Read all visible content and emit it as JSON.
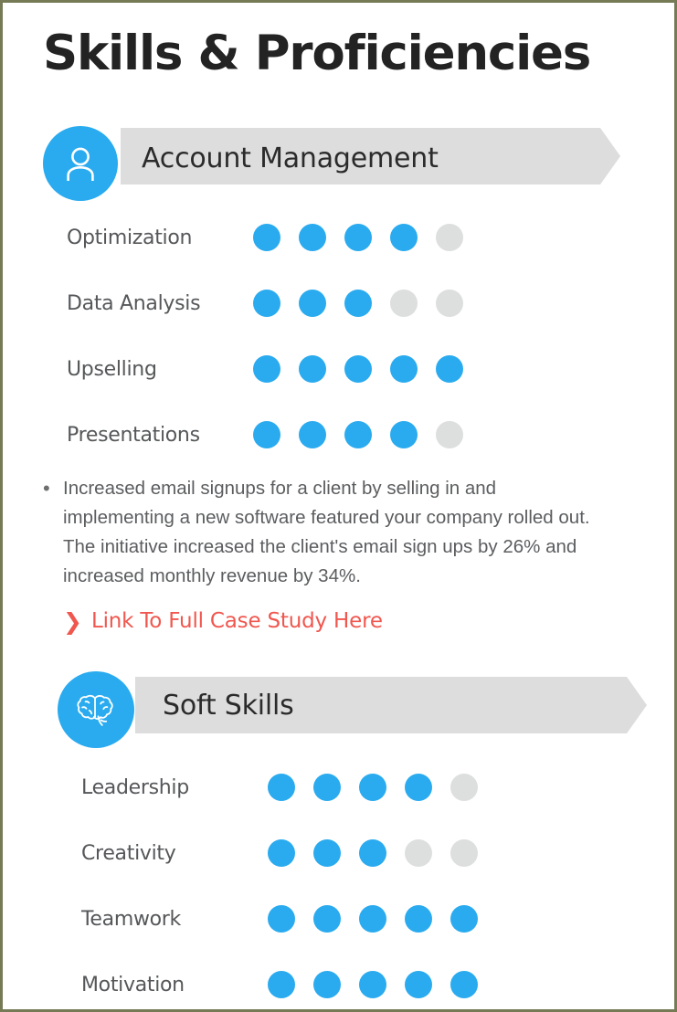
{
  "page": {
    "title": "Skills & Proficiencies",
    "accent_color": "#2aabef",
    "inactive_dot_color": "#dddede",
    "banner_color": "#dddddd",
    "link_color": "#f0574f",
    "label_color": "#555759",
    "border_color": "#767a55"
  },
  "sections": [
    {
      "id": "account-management",
      "title": "Account Management",
      "icon": "person-icon",
      "skills": [
        {
          "label": "Optimization",
          "rating": 4,
          "max": 5
        },
        {
          "label": "Data Analysis",
          "rating": 3,
          "max": 5
        },
        {
          "label": "Upselling",
          "rating": 5,
          "max": 5
        },
        {
          "label": "Presentations",
          "rating": 4,
          "max": 5
        }
      ],
      "bullets": [
        "Increased email signups for a client by selling in and implementing a new software featured your company rolled out. The initiative increased the client's email sign ups by 26% and increased monthly revenue by 34%."
      ],
      "link": {
        "text": "Link To Full Case Study Here",
        "chevron": "❯"
      }
    },
    {
      "id": "soft-skills",
      "title": "Soft Skills",
      "icon": "brain-icon",
      "skills": [
        {
          "label": "Leadership",
          "rating": 4,
          "max": 5
        },
        {
          "label": "Creativity",
          "rating": 3,
          "max": 5
        },
        {
          "label": "Teamwork",
          "rating": 5,
          "max": 5
        },
        {
          "label": "Motivation",
          "rating": 5,
          "max": 5
        }
      ]
    }
  ],
  "bullet_marker": "•"
}
